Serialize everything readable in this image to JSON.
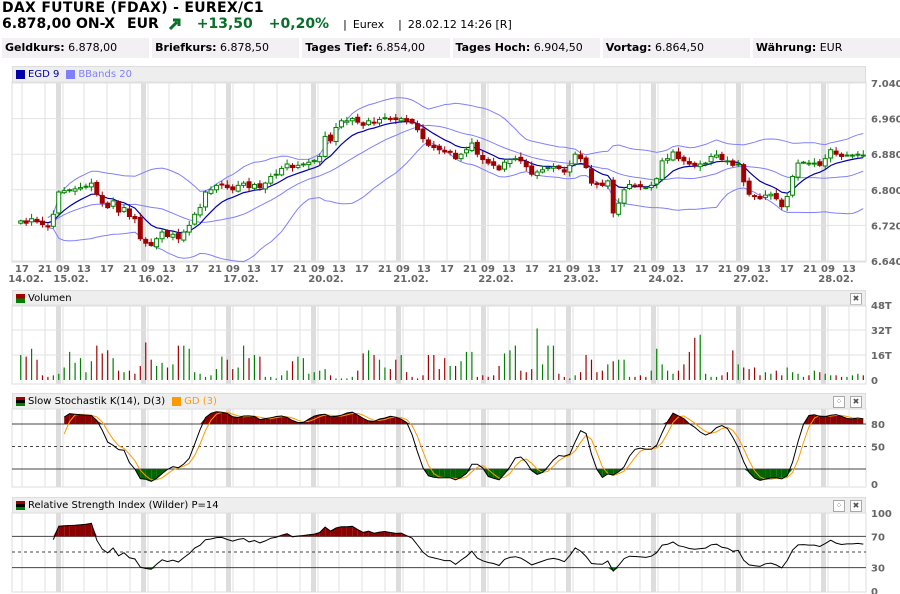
{
  "header": {
    "title": "DAX FUTURE (FDAX) - EUREX/C1",
    "price": "6.878,00 ON-X",
    "currency": "EUR",
    "change": "+13,50",
    "change_pct": "+0,20%",
    "exchange": "Eurex",
    "datetime": "28.02.12 14:26 [R]",
    "trend_icon": "arrow-up-right"
  },
  "info": [
    {
      "label": "Geldkurs:",
      "value": "6.878,00"
    },
    {
      "label": "Briefkurs:",
      "value": "6.878,50"
    },
    {
      "label": "Tages Tief:",
      "value": "6.854,00"
    },
    {
      "label": "Tages Hoch:",
      "value": "6.904,50"
    },
    {
      "label": "Vortag:",
      "value": "6.864,50"
    },
    {
      "label": "Währung:",
      "value": "EUR"
    }
  ],
  "colors": {
    "up": "#008000",
    "down": "#a00000",
    "ema": "#0000aa",
    "bbands": "#8080ff",
    "gd": "#ff9900"
  },
  "chart_data": [
    {
      "type": "candlestick",
      "title": "Price",
      "legend": [
        "EGD 9",
        "BBands 20"
      ],
      "ylim": [
        6640,
        7040
      ],
      "yticks": [
        "7.040",
        "6.960",
        "6.880",
        "6.800",
        "6.720",
        "6.640"
      ],
      "ytick_values": [
        7040,
        6960,
        6880,
        6800,
        6720,
        6640
      ],
      "hour_ticks": [
        "17",
        "21",
        "09",
        "13",
        "17",
        "21",
        "09",
        "13",
        "17",
        "21",
        "09",
        "13",
        "17",
        "21",
        "09",
        "13",
        "17",
        "21",
        "09",
        "13",
        "17",
        "21",
        "09",
        "13",
        "17",
        "21",
        "09",
        "13",
        "17",
        "21",
        "09",
        "13",
        "17",
        "21",
        "09",
        "13",
        "17",
        "21",
        "09",
        "13"
      ],
      "dates": [
        "14.02.",
        "15.02.",
        "16.02.",
        "17.02.",
        "20.02.",
        "21.02.",
        "22.02.",
        "23.02.",
        "24.02.",
        "27.02.",
        "28.02."
      ],
      "close": [
        6730,
        6725,
        6735,
        6728,
        6722,
        6718,
        6745,
        6795,
        6798,
        6800,
        6802,
        6805,
        6808,
        6815,
        6790,
        6770,
        6760,
        6775,
        6750,
        6760,
        6740,
        6735,
        6690,
        6680,
        6675,
        6690,
        6705,
        6695,
        6700,
        6690,
        6705,
        6720,
        6745,
        6760,
        6795,
        6800,
        6810,
        6812,
        6805,
        6800,
        6810,
        6815,
        6805,
        6812,
        6805,
        6815,
        6830,
        6835,
        6848,
        6858,
        6850,
        6855,
        6858,
        6862,
        6866,
        6875,
        6920,
        6910,
        6940,
        6955,
        6955,
        6960,
        6952,
        6945,
        6955,
        6950,
        6958,
        6962,
        6960,
        6958,
        6960,
        6955,
        6950,
        6935,
        6915,
        6900,
        6895,
        6890,
        6885,
        6885,
        6870,
        6880,
        6890,
        6905,
        6880,
        6868,
        6860,
        6855,
        6845,
        6862,
        6868,
        6870,
        6865,
        6852,
        6835,
        6840,
        6845,
        6850,
        6852,
        6848,
        6840,
        6855,
        6880,
        6870,
        6850,
        6815,
        6812,
        6810,
        6820,
        6748,
        6770,
        6800,
        6812,
        6810,
        6808,
        6805,
        6810,
        6825,
        6865,
        6870,
        6885,
        6870,
        6865,
        6858,
        6855,
        6858,
        6860,
        6875,
        6878,
        6868,
        6865,
        6855,
        6858,
        6818,
        6790,
        6785,
        6780,
        6788,
        6790,
        6780,
        6762,
        6785,
        6830,
        6860,
        6862,
        6860,
        6860,
        6855,
        6870,
        6890,
        6880,
        6875,
        6878,
        6878,
        6880,
        6878
      ]
    },
    {
      "type": "bar",
      "title": "Volumen",
      "ylim": [
        0,
        48
      ],
      "yticks": [
        "48T",
        "32T",
        "16T",
        "0"
      ],
      "ytick_values": [
        48,
        32,
        16,
        0
      ],
      "values": [
        16,
        15,
        20,
        13,
        3,
        2,
        3,
        4,
        8,
        18,
        11,
        14,
        5,
        12,
        22,
        17,
        19,
        14,
        6,
        5,
        6,
        4,
        9,
        24,
        13,
        9,
        11,
        8,
        10,
        22,
        22,
        20,
        5,
        4,
        2,
        3,
        7,
        15,
        13,
        7,
        8,
        22,
        14,
        16,
        15,
        2,
        2,
        1,
        3,
        6,
        12,
        15,
        14,
        4,
        5,
        6,
        7,
        3,
        1,
        1,
        1,
        2,
        6,
        17,
        19,
        16,
        13,
        8,
        7,
        13,
        16,
        5,
        2,
        1,
        3,
        16,
        16,
        7,
        14,
        9,
        9,
        12,
        18,
        18,
        2,
        3,
        2,
        3,
        9,
        17,
        19,
        22,
        6,
        5,
        7,
        33,
        10,
        22,
        22,
        4,
        2,
        1,
        3,
        5,
        16,
        13,
        5,
        6,
        10,
        12,
        13,
        13,
        2,
        2,
        3,
        2,
        6,
        20,
        10,
        6,
        4,
        6,
        10,
        18,
        27,
        29,
        4,
        2,
        2,
        3,
        5,
        19,
        10,
        8,
        7,
        8,
        3,
        5,
        4,
        6,
        3,
        8,
        5,
        4,
        2,
        3,
        6,
        5,
        4,
        3,
        3,
        2,
        2,
        3,
        4,
        3
      ]
    },
    {
      "type": "line",
      "title": "Slow Stochastik K(14), D(3)",
      "legend": [
        "Slow Stochastik K(14), D(3)",
        "GD (3)"
      ],
      "ylim": [
        0,
        100
      ],
      "yticks": [
        "80",
        "50",
        "0"
      ],
      "ytick_values": [
        80,
        50,
        0
      ],
      "levels": [
        80,
        20
      ]
    },
    {
      "type": "line",
      "title": "Relative Strength Index (Wilder) P=14",
      "ylim": [
        0,
        100
      ],
      "yticks": [
        "100",
        "70",
        "30",
        "0"
      ],
      "ytick_values": [
        100,
        70,
        30,
        0
      ],
      "levels": [
        70,
        30
      ]
    }
  ]
}
